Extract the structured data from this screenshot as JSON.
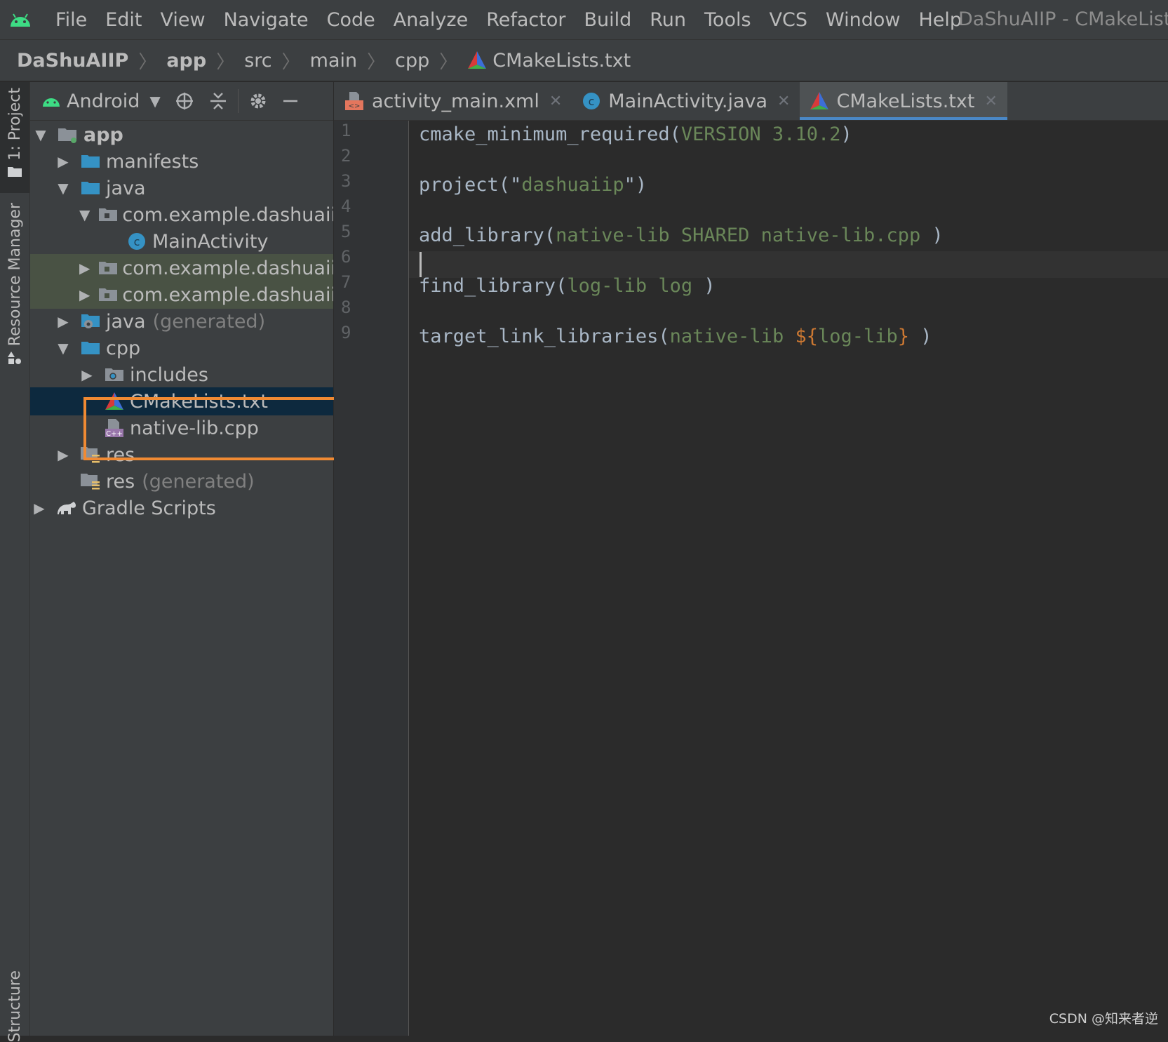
{
  "menubar": {
    "items": [
      "File",
      "Edit",
      "View",
      "Navigate",
      "Code",
      "Analyze",
      "Refactor",
      "Build",
      "Run",
      "Tools",
      "VCS",
      "Window",
      "Help"
    ],
    "window_title": "DaShuAIIP - CMakeLists"
  },
  "breadcrumb": {
    "items": [
      "DaShuAIIP",
      "app",
      "src",
      "main",
      "cpp",
      "CMakeLists.txt"
    ]
  },
  "side_tabs": {
    "project": "1: Project",
    "resource_manager": "Resource Manager",
    "structure": "Structure"
  },
  "project_toolbar": {
    "view_mode": "Android"
  },
  "tree": {
    "app": "app",
    "manifests": "manifests",
    "java": "java",
    "pkg_main": "com.example.dashuaiip",
    "main_activity": "MainActivity",
    "pkg_test1": "com.example.dashuaiip",
    "pkg_test2": "com.example.dashuaiip",
    "java_generated": "java",
    "java_generated_suffix": "(generated)",
    "cpp": "cpp",
    "includes": "includes",
    "cmakelists": "CMakeLists.txt",
    "native_lib": "native-lib.cpp",
    "res": "res",
    "res_generated": "res",
    "res_generated_suffix": "(generated)",
    "gradle_scripts": "Gradle Scripts"
  },
  "tabs": [
    {
      "label": "activity_main.xml"
    },
    {
      "label": "MainActivity.java"
    },
    {
      "label": "CMakeLists.txt"
    }
  ],
  "editor": {
    "line_numbers": [
      "1",
      "2",
      "3",
      "4",
      "5",
      "6",
      "7",
      "8",
      "9"
    ],
    "lines": {
      "l1": {
        "fn": "cmake_minimum_required",
        "open": "(",
        "arg": "VERSION 3.10.2",
        "close": ")"
      },
      "l3": {
        "fn": "project",
        "open": "(",
        "q1": "\"",
        "arg": "dashuaiip",
        "q2": "\"",
        "close": ")"
      },
      "l5": {
        "fn": "add_library",
        "open": "(",
        "arg": "native-lib SHARED native-lib.cpp",
        "close": " )"
      },
      "l7": {
        "fn": "find_library",
        "open": "(",
        "arg": "log-lib log",
        "close": " )"
      },
      "l9": {
        "fn": "target_link_libraries",
        "open": "(",
        "arg": "native-lib ",
        "var_open": "${",
        "var": "log-lib",
        "var_close": "}",
        "close": " )"
      }
    }
  },
  "watermark": "CSDN @知来者逆",
  "colors": {
    "accent": "#4a88c7",
    "highlight_box": "#f08a33",
    "selection": "#0d293e",
    "string_green": "#6a8759",
    "variable_orange": "#cc7832"
  }
}
